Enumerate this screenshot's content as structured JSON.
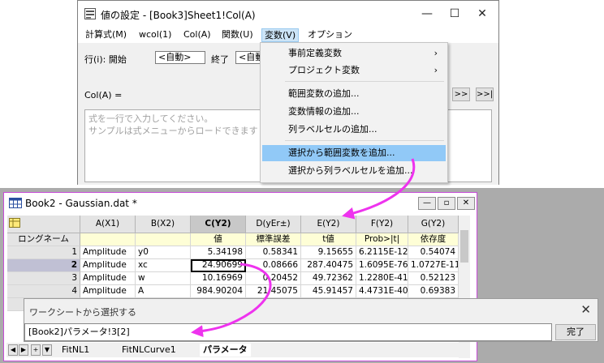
{
  "set_values": {
    "title": "値の設定 - [Book3]Sheet1!Col(A)",
    "menu": [
      "計算式(M)",
      "wcol(1)",
      "Col(A)",
      "関数(U)",
      "変数(V)",
      "オプション"
    ],
    "row_label": "行(i): 開始",
    "start_value": "<自動>",
    "end_label": "終了",
    "end_value": "<自動",
    "col_label": "Col(A) =",
    "nav_buttons": [
      ">>",
      ">>|"
    ],
    "formula_placeholder_1": "式を一行で入力してください。",
    "formula_placeholder_2": "サンプルは式メニューからロードできます"
  },
  "variables_menu": {
    "items": [
      {
        "label": "事前定義変数",
        "submenu": true
      },
      {
        "label": "プロジェクト変数",
        "submenu": true
      },
      {
        "label": "範囲変数の追加...",
        "submenu": false
      },
      {
        "label": "変数情報の追加...",
        "submenu": false
      },
      {
        "label": "列ラベルセルの追加...",
        "submenu": false
      },
      {
        "label": "選択から範囲変数を追加...",
        "submenu": false,
        "highlighted": true
      },
      {
        "label": "選択から列ラベルセルを追加...",
        "submenu": false
      }
    ]
  },
  "workbook": {
    "title": "Book2 - Gaussian.dat *",
    "columns": [
      "A(X1)",
      "B(X2)",
      "C(Y2)",
      "D(yEr±)",
      "E(Y2)",
      "F(Y2)",
      "G(Y2)"
    ],
    "longname_label": "ロングネーム",
    "longnames": [
      "",
      "",
      "値",
      "標準誤差",
      "t値",
      "Prob>|t|",
      "依存度"
    ],
    "rows": [
      {
        "n": "1",
        "cells": [
          "Amplitude",
          "y0",
          "5.34198",
          "0.58341",
          "9.15655",
          "6.2115E-12",
          "0.54074"
        ]
      },
      {
        "n": "2",
        "cells": [
          "Amplitude",
          "xc",
          "24.90699",
          "0.08666",
          "287.40475",
          "1.6095E-76",
          "1.0727E-11"
        ]
      },
      {
        "n": "3",
        "cells": [
          "Amplitude",
          "w",
          "10.16969",
          "0.20452",
          "49.72362",
          "1.2280E-41",
          "0.52123"
        ]
      },
      {
        "n": "4",
        "cells": [
          "Amplitude",
          "A",
          "984.90204",
          "21.45075",
          "45.91457",
          "4.4731E-40",
          "0.69383"
        ]
      }
    ],
    "tabs": [
      "FitNL1",
      "FitNLCurve1",
      "パラメータ"
    ]
  },
  "select_from_ws": {
    "title": "ワークシートから選択する",
    "value": "[Book2]パラメータ!3[2]",
    "done_label": "完了"
  },
  "colors": {
    "arrow": "#ee33ee",
    "menu_highlight": "#91c9f7",
    "longname_bg": "#fefed6"
  }
}
